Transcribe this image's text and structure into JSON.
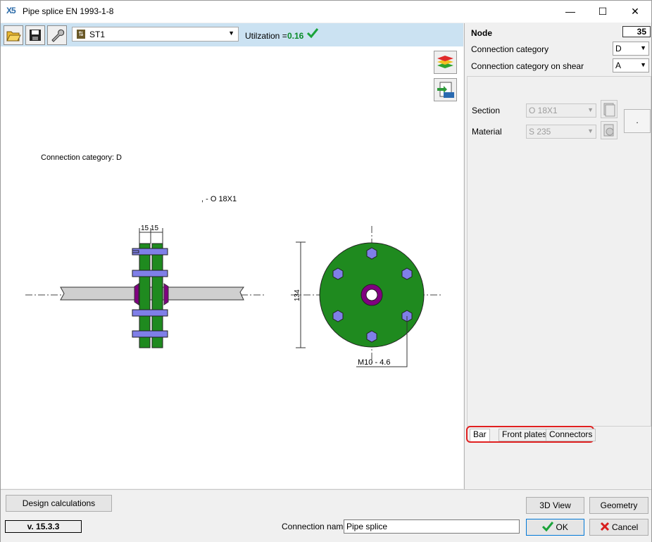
{
  "window": {
    "title": "Pipe splice EN 1993-1-8",
    "app_icon": "X5",
    "minimize": "—",
    "maximize": "☐",
    "close": "✕"
  },
  "toolbar": {
    "icons": [
      "open-folder-icon",
      "save-icon",
      "wrench-icon"
    ],
    "config_value": "ST1",
    "utilization_label": "Utilzation =",
    "utilization_value": "0.16",
    "colors": {
      "toolbar_bg": "#cbe2f2",
      "util_green": "#0a8a2a"
    }
  },
  "drawing": {
    "connection_category_text": "Connection category:  D",
    "section_text": ",  - O  18X1",
    "dim_top": "15 15",
    "dim_left": "134",
    "bolt_label": "M10 - 4.6",
    "colors": {
      "plate": "#1f8a1f",
      "bolt": "#7f7fe8",
      "pipe_section": "#800080",
      "pipe": "#cfcfcf"
    }
  },
  "panel": {
    "node_label": "Node",
    "node_value": "35",
    "connection_category_label": "Connection category",
    "connection_category_value": "D",
    "shear_label": "Connection category on shear",
    "shear_value": "A",
    "section_label": "Section",
    "section_value": "O  18X1",
    "material_label": "Material",
    "material_value": "S 235",
    "dot_button": ".",
    "tabs": [
      "Bar",
      "Front plates",
      "Connectors"
    ]
  },
  "footer": {
    "design_calc": "Design calculations",
    "version": "v. 15.3.3",
    "view3d": "3D View",
    "geometry": "Geometry",
    "conn_name_label": "Connection name",
    "conn_name_value": "Pipe splice",
    "ok": "OK",
    "cancel": "Cancel"
  }
}
